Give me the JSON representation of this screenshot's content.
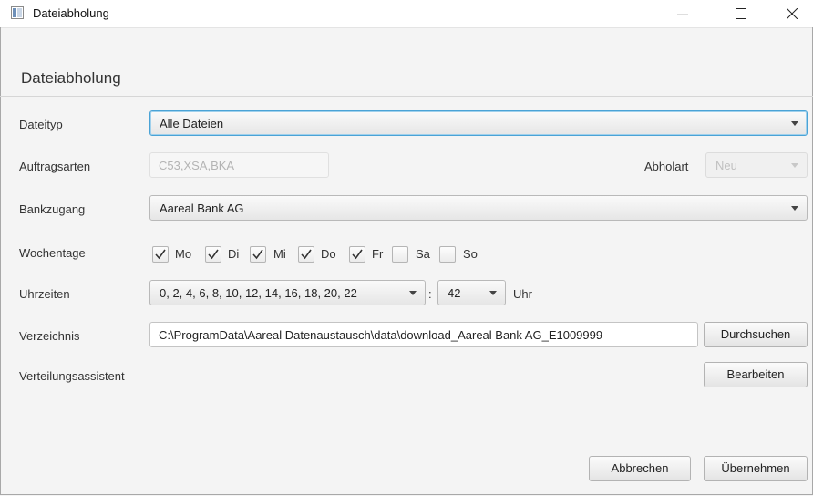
{
  "window": {
    "title": "Dateiabholung"
  },
  "header": {
    "title": "Dateiabholung"
  },
  "form": {
    "dateityp": {
      "label": "Dateityp",
      "value": "Alle Dateien"
    },
    "auftragsarten": {
      "label": "Auftragsarten",
      "value": "C53,XSA,BKA"
    },
    "abholart": {
      "label": "Abholart",
      "value": "Neu"
    },
    "bankzugang": {
      "label": "Bankzugang",
      "value": "Aareal Bank AG"
    },
    "wochentage": {
      "label": "Wochentage",
      "days": [
        {
          "label": "Mo",
          "checked": true
        },
        {
          "label": "Di",
          "checked": true
        },
        {
          "label": "Mi",
          "checked": true
        },
        {
          "label": "Do",
          "checked": true
        },
        {
          "label": "Fr",
          "checked": true
        },
        {
          "label": "Sa",
          "checked": false
        },
        {
          "label": "So",
          "checked": false
        }
      ]
    },
    "uhrzeiten": {
      "label": "Uhrzeiten",
      "hours": "0, 2, 4, 6, 8, 10, 12, 14, 16, 18, 20, 22",
      "separator": ":",
      "minute": "42",
      "unit": "Uhr"
    },
    "verzeichnis": {
      "label": "Verzeichnis",
      "value": "C:\\ProgramData\\Aareal Datenaustausch\\data\\download_Aareal Bank AG_E1009999",
      "browse_label": "Durchsuchen"
    },
    "verteilungsassistent": {
      "label": "Verteilungsassistent",
      "edit_label": "Bearbeiten"
    }
  },
  "footer": {
    "cancel_label": "Abbrechen",
    "apply_label": "Übernehmen"
  }
}
